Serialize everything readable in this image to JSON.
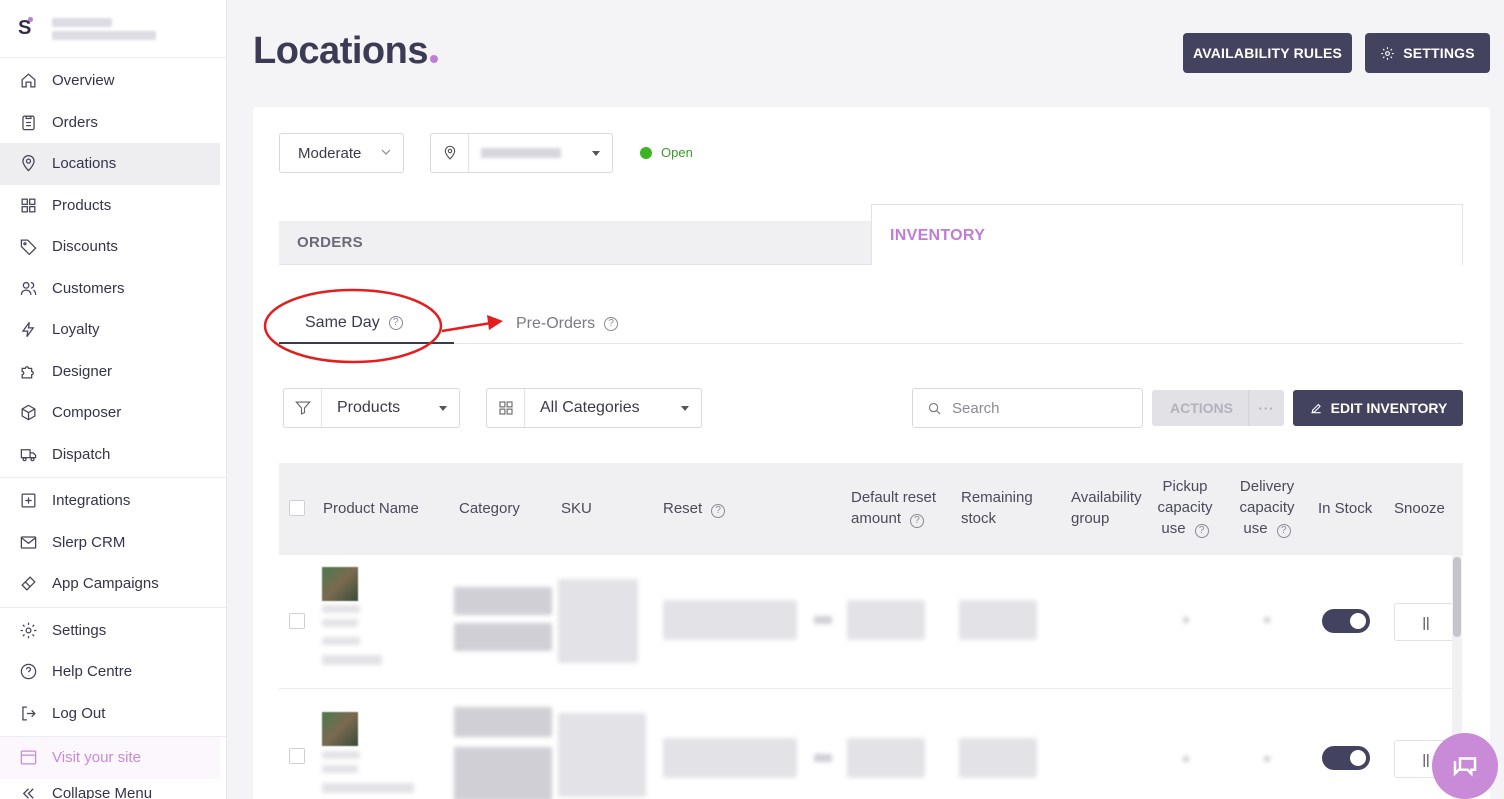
{
  "sidebar": {
    "items": [
      {
        "label": "Overview"
      },
      {
        "label": "Orders"
      },
      {
        "label": "Locations"
      },
      {
        "label": "Products"
      },
      {
        "label": "Discounts"
      },
      {
        "label": "Customers"
      },
      {
        "label": "Loyalty"
      },
      {
        "label": "Designer"
      },
      {
        "label": "Composer"
      },
      {
        "label": "Dispatch"
      }
    ],
    "items2": [
      {
        "label": "Integrations"
      },
      {
        "label": "Slerp CRM"
      },
      {
        "label": "App Campaigns"
      }
    ],
    "items3": [
      {
        "label": "Settings"
      },
      {
        "label": "Help Centre"
      },
      {
        "label": "Log Out"
      }
    ],
    "visit_site": "Visit your site",
    "collapse": "Collapse Menu",
    "logo_letter": "S"
  },
  "header": {
    "title": "Locations",
    "availability_rules": "AVAILABILITY RULES",
    "settings": "SETTINGS"
  },
  "filters": {
    "mode": "Moderate",
    "status": "Open"
  },
  "tabs": {
    "orders": "ORDERS",
    "inventory": "INVENTORY"
  },
  "subtabs": {
    "same_day": "Same Day",
    "pre_orders": "Pre-Orders",
    "help_glyph": "?"
  },
  "toolbar": {
    "products": "Products",
    "categories": "All Categories",
    "search_placeholder": "Search",
    "actions": "ACTIONS",
    "more": "···",
    "edit_inventory": "EDIT INVENTORY"
  },
  "table": {
    "headers": {
      "product_name": "Product Name",
      "category": "Category",
      "sku": "SKU",
      "reset": "Reset",
      "default_reset_1": "Default reset",
      "default_reset_2": "amount",
      "remaining_1": "Remaining",
      "remaining_2": "stock",
      "availability_1": "Availability",
      "availability_2": "group",
      "pickup_1": "Pickup",
      "pickup_2": "capacity",
      "pickup_3": "use",
      "delivery_1": "Delivery",
      "delivery_2": "capacity",
      "delivery_3": "use",
      "in_stock": "In Stock",
      "snooze": "Snooze"
    },
    "snooze_glyph": "||"
  },
  "colors": {
    "brand_dark": "#434360",
    "accent": "#c07cd6",
    "open_green": "#3bb524",
    "annotation_red": "#e41e1e"
  }
}
